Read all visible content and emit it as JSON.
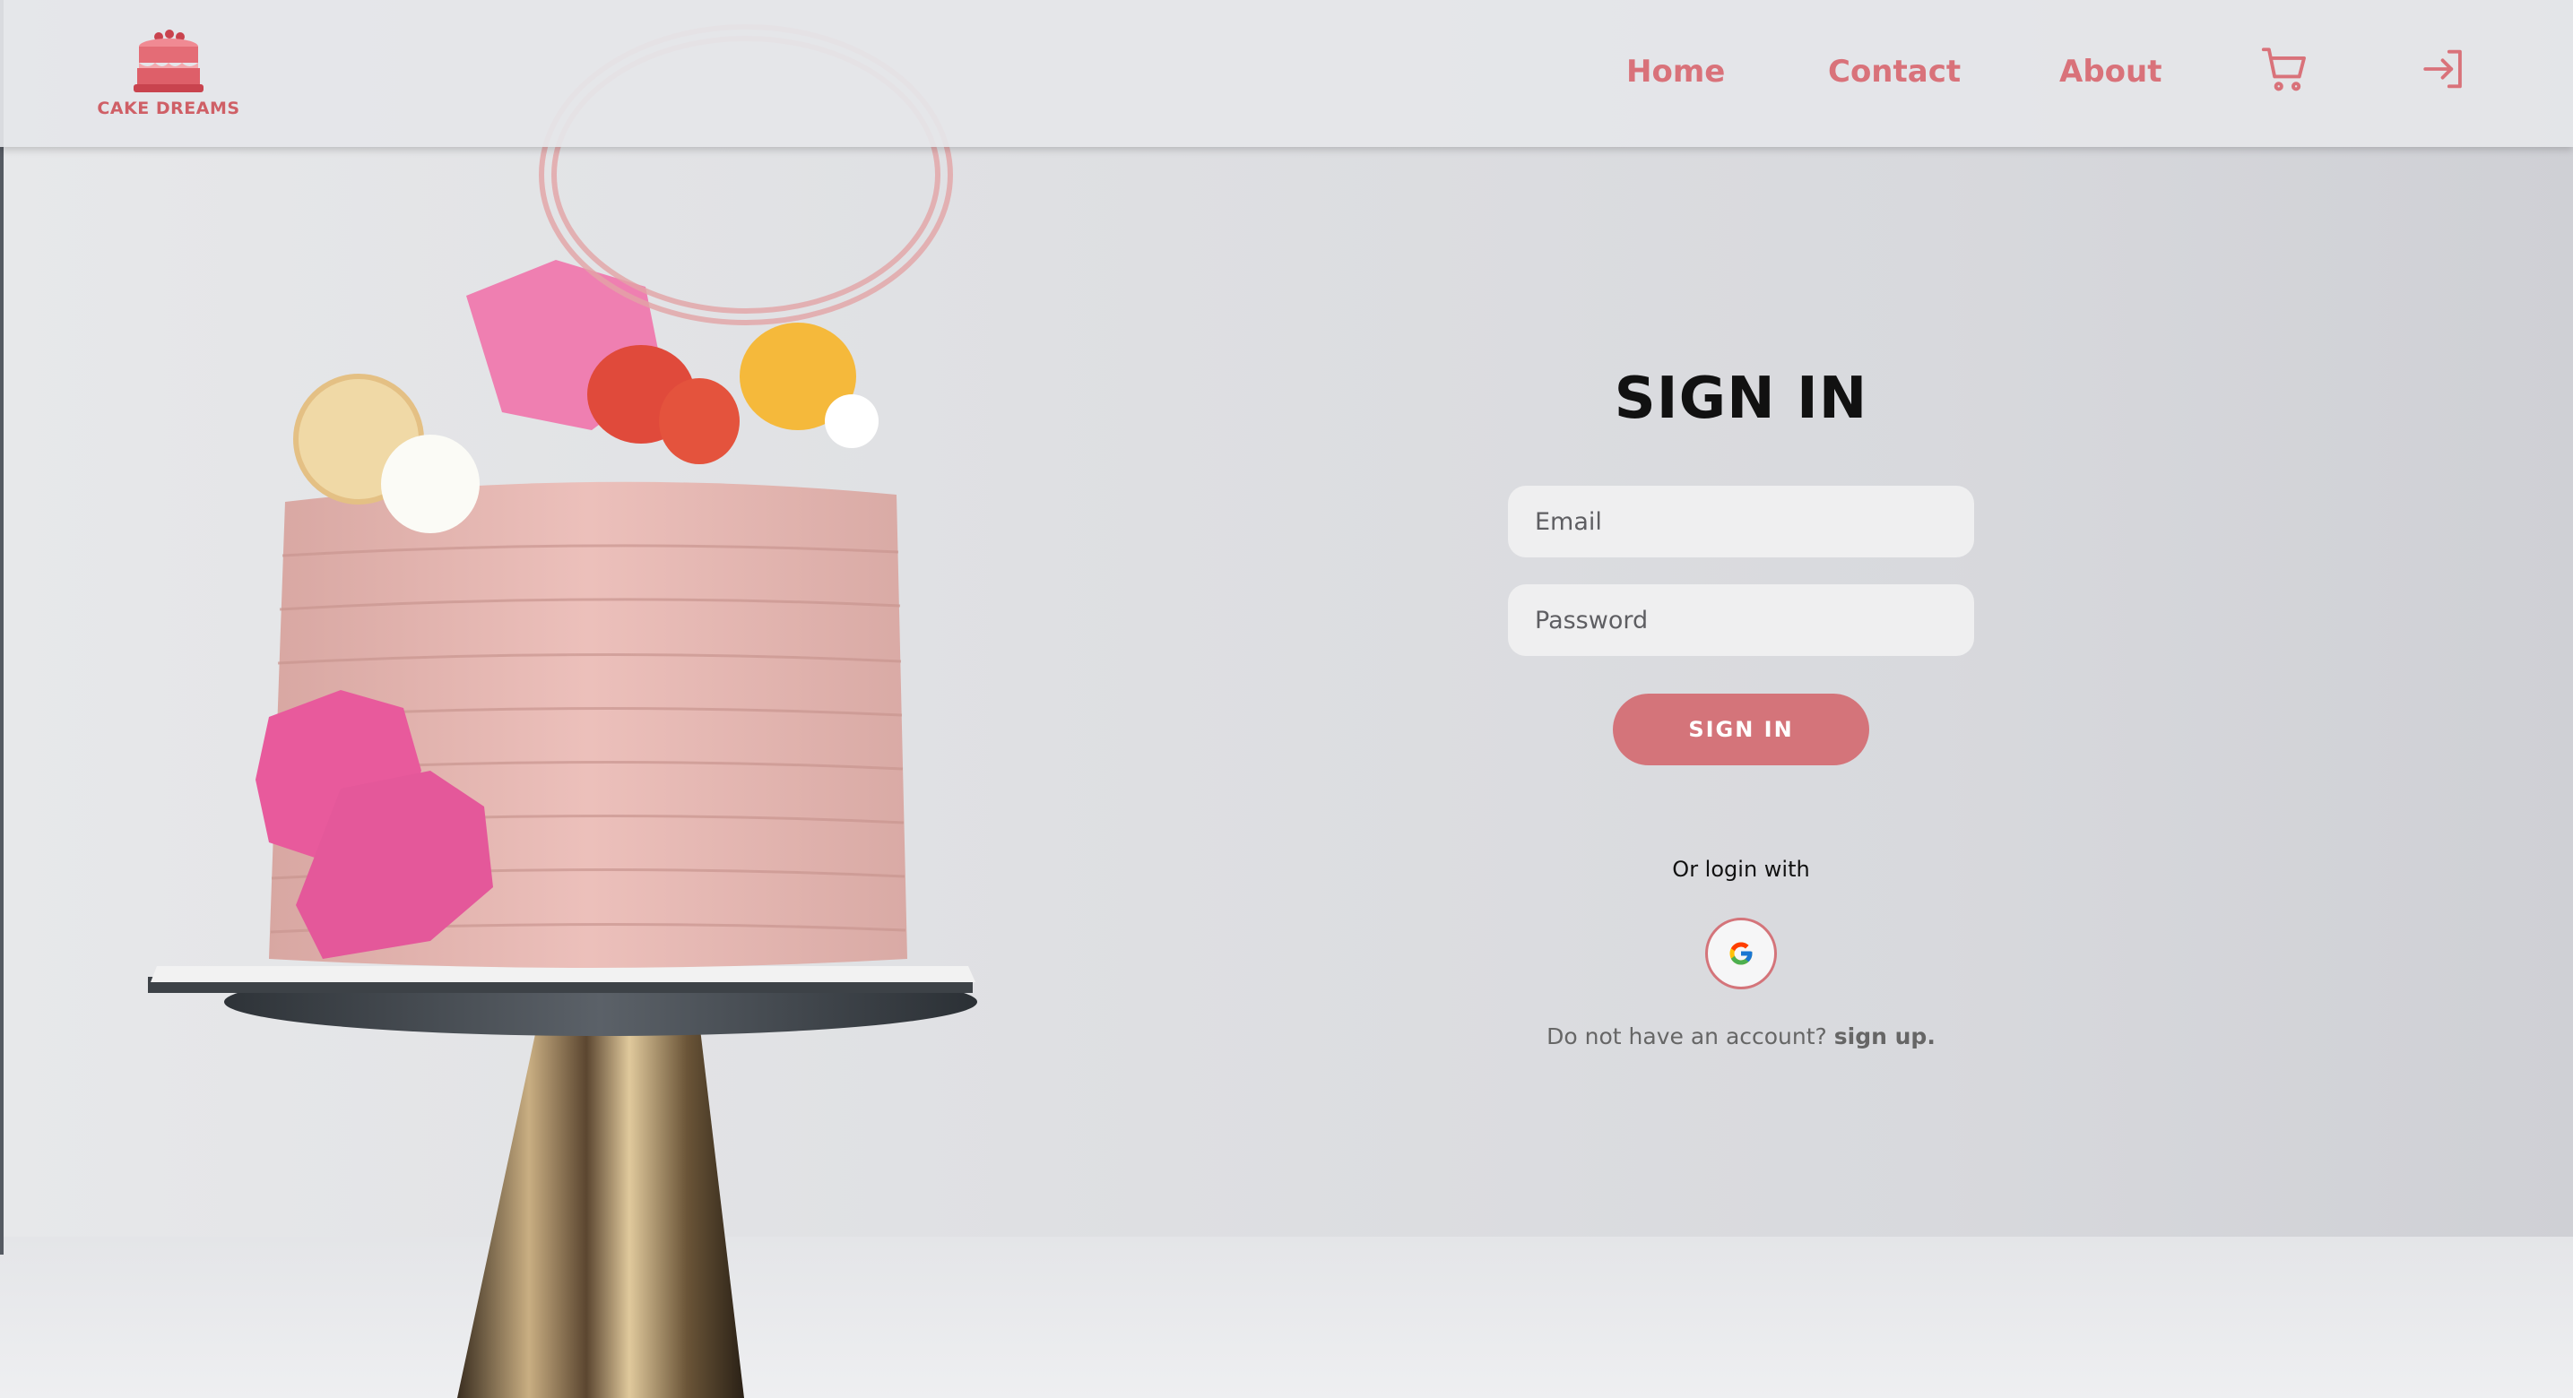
{
  "brand": {
    "name": "CAKE DREAMS"
  },
  "nav": {
    "home": "Home",
    "contact": "Contact",
    "about": "About"
  },
  "icons": {
    "logo": "cake-icon",
    "cart": "cart-icon",
    "login": "login-icon",
    "google": "google-icon"
  },
  "form": {
    "title": "SIGN IN",
    "email_placeholder": "Email",
    "password_placeholder": "Password",
    "submit_label": "SIGN IN",
    "or_text": "Or login with",
    "signup_prompt": "Do not have an account?",
    "signup_link": "sign up."
  },
  "colors": {
    "accent": "#d4747a",
    "nav_text": "#d9727a",
    "title_text": "#111111"
  }
}
